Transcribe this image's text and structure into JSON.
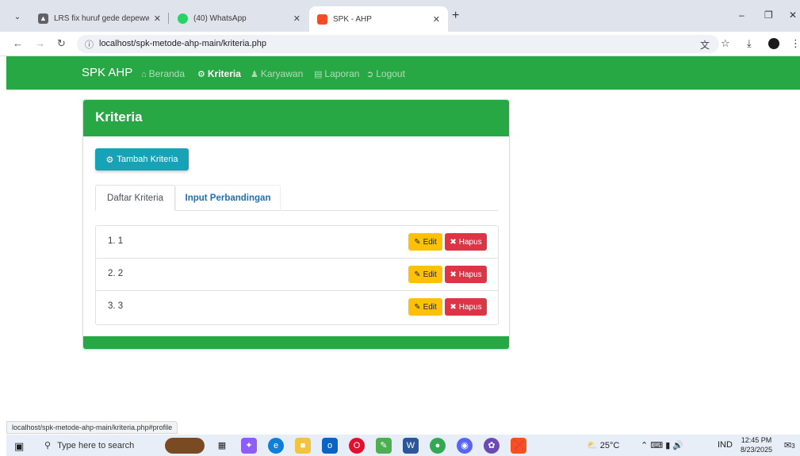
{
  "browser": {
    "tabs": [
      {
        "title": "LRS fix huruf gede depeww.drav",
        "active": false
      },
      {
        "title": "(40) WhatsApp",
        "active": false
      },
      {
        "title": "SPK - AHP",
        "active": true
      }
    ],
    "url": "localhost/spk-metode-ahp-main/kriteria.php",
    "status_url": "localhost/spk-metode-ahp-main/kriteria.php#profile"
  },
  "navbar": {
    "brand": "SPK AHP",
    "items": [
      {
        "label": "Beranda",
        "icon": "home-icon",
        "active": false
      },
      {
        "label": "Kriteria",
        "icon": "users-cog-icon",
        "active": true
      },
      {
        "label": "Karyawan",
        "icon": "users-icon",
        "active": false
      },
      {
        "label": "Laporan",
        "icon": "clipboard-icon",
        "active": false
      },
      {
        "label": "Logout",
        "icon": "sign-out-icon",
        "active": false
      }
    ]
  },
  "card": {
    "title": "Kriteria",
    "add_button": "Tambah Kriteria",
    "tabs": [
      {
        "label": "Daftar Kriteria",
        "active": true
      },
      {
        "label": "Input Perbandingan",
        "active": false
      }
    ],
    "rows": [
      {
        "label": "1. 1"
      },
      {
        "label": "2. 2"
      },
      {
        "label": "3. 3"
      }
    ],
    "edit_label": "Edit",
    "delete_label": "Hapus"
  },
  "taskbar": {
    "search_placeholder": "Type here to search",
    "weather": "25°C",
    "language": "IND",
    "time": "12:45 PM",
    "date": "8/23/2025",
    "notification_count": "3"
  },
  "colors": {
    "primary_green": "#28a745",
    "info": "#17a2b8",
    "warning": "#ffc107",
    "danger": "#dc3545"
  }
}
